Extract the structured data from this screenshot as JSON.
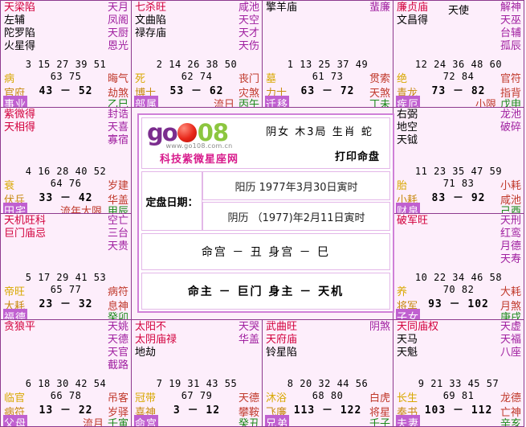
{
  "center": {
    "logo": {
      "go": "go",
      "num": "08",
      "url": "www.go108.com.cn",
      "cn": "科技紫微星座网"
    },
    "gender_line": "阴女  木3局  生肖 蛇",
    "print_label": "打印命盘",
    "dates_label": "定盘日期：",
    "solar_date": "阳历  1977年3月30日寅时",
    "lunar_date": "阴历 （1977)年2月11日寅时",
    "gong_line": "命宫 － 丑   身宫 － 巳",
    "zhu_line": "命主 － 巨门   身主 － 天机"
  },
  "cells": [
    {
      "id": "si",
      "stars_main": [
        "天梁陷"
      ],
      "stars_plain": [
        "左辅",
        "陀罗陷",
        "火星得"
      ],
      "minors": [
        "天月",
        "凤阁",
        "天厨",
        "恩光"
      ],
      "ages1": "3  15  27  39  51",
      "ages2": "63  75",
      "daxian": "43 － 52",
      "zhangsheng": "病",
      "boshi": "官府",
      "palace": "事业",
      "shensha1": "晦气",
      "shensha2": "劫煞",
      "ganzhi": "乙巳",
      "flow": ""
    },
    {
      "id": "wu",
      "stars_main": [
        "七杀旺"
      ],
      "stars_plain": [
        "文曲陷",
        "禄存庙"
      ],
      "minors": [
        "咸池",
        "天空",
        "天才",
        "天伤"
      ],
      "ages1": "2  14  26  38  50",
      "ages2": "62  74",
      "daxian": "53 － 62",
      "zhangsheng": "死",
      "boshi": "博士",
      "palace": "部属",
      "shensha1": "丧门",
      "shensha2": "灾煞",
      "ganzhi": "丙午",
      "flow": "流日"
    },
    {
      "id": "wei",
      "stars_main": [],
      "stars_plain": [
        "擎羊庙"
      ],
      "minors": [
        "蜚廉"
      ],
      "ages1": "1  13  25  37  49",
      "ages2": "61  73",
      "daxian": "63 － 72",
      "zhangsheng": "墓",
      "boshi": "力士",
      "palace": "迁移",
      "shensha1": "贯索",
      "shensha2": "天煞",
      "ganzhi": "丁未",
      "flow": ""
    },
    {
      "id": "shen",
      "stars_main": [
        "廉贞庙"
      ],
      "stars_plain": [
        "文昌得"
      ],
      "stars_top_center": "天使",
      "minors": [
        "解神",
        "天巫",
        "台辅",
        "孤辰"
      ],
      "ages1": "12  24  36  48  60",
      "ages2": "72  84",
      "daxian": "73 － 82",
      "zhangsheng": "绝",
      "boshi": "青龙",
      "palace": "疾厄",
      "shensha1": "官符",
      "shensha2": "指背",
      "ganzhi": "戊申",
      "flow": "小限"
    },
    {
      "id": "chen",
      "stars_main": [
        "紫微得",
        "天相得"
      ],
      "stars_plain": [],
      "minors": [
        "封诰",
        "天喜",
        "寡宿"
      ],
      "ages1": "4  16  28  40  52",
      "ages2": "64  76",
      "daxian": "33 － 42",
      "zhangsheng": "衰",
      "boshi": "伏兵",
      "palace": "田宅",
      "shensha1": "岁建",
      "shensha2": "华盖",
      "ganzhi": "甲辰",
      "flow": "流年大限"
    },
    {
      "id": "you",
      "stars_main": [],
      "stars_plain": [
        "右弼",
        "地空",
        "天钺"
      ],
      "minors": [
        "龙池",
        "破碎"
      ],
      "ages1": "11  23  35  47  59",
      "ages2": "71  83",
      "daxian": "83 － 92",
      "zhangsheng": "胎",
      "boshi": "小耗",
      "palace": "财帛",
      "shensha1": "小耗",
      "shensha2": "咸池",
      "ganzhi": "己酉",
      "flow": ""
    },
    {
      "id": "mao",
      "stars_main": [
        "天机旺科",
        "巨门庙忌"
      ],
      "stars_plain": [],
      "minors": [
        "空亡",
        "三台",
        "天贵"
      ],
      "ages1": "5  17  29  41  53",
      "ages2": "65  77",
      "daxian": "23 － 32",
      "zhangsheng": "帝旺",
      "boshi": "大耗",
      "palace": "福德",
      "shensha1": "病符",
      "shensha2": "息神",
      "ganzhi": "癸卯",
      "flow": ""
    },
    {
      "id": "xu",
      "stars_main": [
        "破军旺"
      ],
      "stars_plain": [],
      "minors": [
        "天刑",
        "红鸾",
        "月德",
        "天寿"
      ],
      "ages1": "10  22  34  46  58",
      "ages2": "70  82",
      "daxian": "93 － 102",
      "zhangsheng": "养",
      "boshi": "将军",
      "palace": "子女",
      "shensha1": "大耗",
      "shensha2": "月煞",
      "ganzhi": "庚戌",
      "flow": ""
    },
    {
      "id": "yin",
      "stars_main": [
        "贪狼平"
      ],
      "stars_plain": [],
      "minors": [
        "天姚",
        "天德",
        "天官",
        "截路"
      ],
      "ages1": "6  18  30  42  54",
      "ages2": "66  78",
      "daxian": "13 － 22",
      "zhangsheng": "临官",
      "boshi": "病符",
      "palace": "父母",
      "shensha1": "吊客",
      "shensha2": "岁驿",
      "ganzhi": "壬寅",
      "flow": "流月"
    },
    {
      "id": "chou",
      "stars_main": [
        "太阳不",
        "太阴庙禄"
      ],
      "stars_plain": [
        "地劫"
      ],
      "minors": [
        "天哭",
        "华盖"
      ],
      "ages1": "7  19  31  43  55",
      "ages2": "67  79",
      "daxian": "3 － 12",
      "zhangsheng": "冠带",
      "boshi": "喜神",
      "palace": "命宫",
      "shensha1": "天德",
      "shensha2": "攀鞍",
      "ganzhi": "癸丑",
      "flow": ""
    },
    {
      "id": "zi",
      "stars_main": [
        "武曲旺",
        "天府庙"
      ],
      "stars_plain": [
        "铃星陷"
      ],
      "minors": [
        "阴煞"
      ],
      "ages1": "8  20  32  44  56",
      "ages2": "68  80",
      "daxian": "113 － 122",
      "zhangsheng": "沐浴",
      "boshi": "飞廉",
      "palace": "兄弟",
      "shensha1": "白虎",
      "shensha2": "将星",
      "ganzhi": "壬子",
      "flow": ""
    },
    {
      "id": "hai",
      "stars_main": [
        "天同庙权"
      ],
      "stars_plain": [
        "天马",
        "天魁"
      ],
      "minors": [
        "天虚",
        "天福",
        "八座"
      ],
      "ages1": "9  21  33  45  57",
      "ages2": "69  81",
      "daxian": "103 － 112",
      "zhangsheng": "长生",
      "boshi": "奏书",
      "palace": "夫妻",
      "shensha1": "龙德",
      "shensha2": "亡神",
      "ganzhi": "辛亥",
      "flow": ""
    }
  ]
}
